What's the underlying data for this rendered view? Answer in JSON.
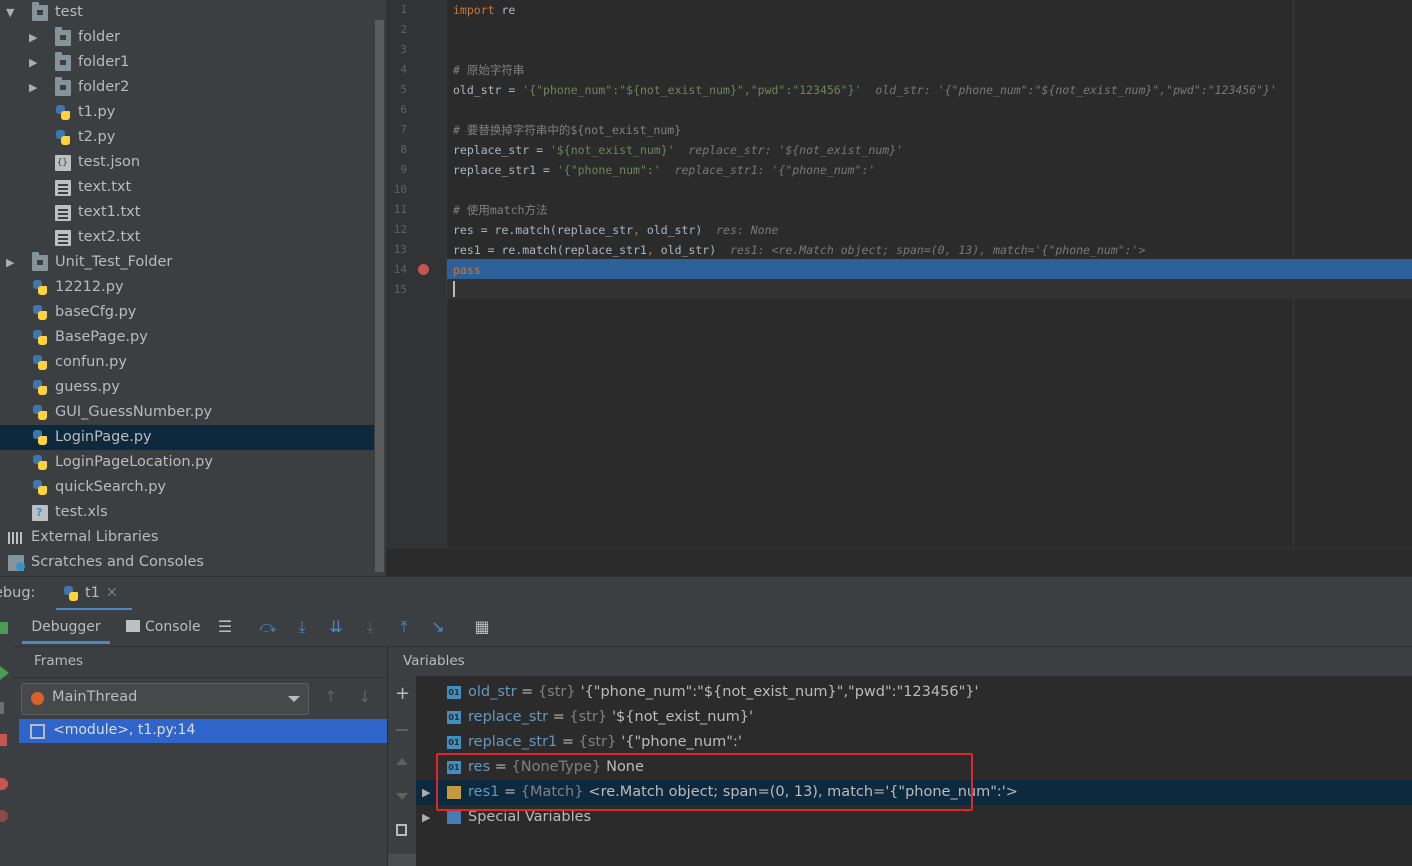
{
  "tree": {
    "items": [
      {
        "label": "test",
        "type": "folder",
        "expanded": true,
        "level": 0
      },
      {
        "label": "folder",
        "type": "folder",
        "expanded": false,
        "level": 1
      },
      {
        "label": "folder1",
        "type": "folder",
        "expanded": false,
        "level": 1
      },
      {
        "label": "folder2",
        "type": "folder",
        "expanded": false,
        "level": 1
      },
      {
        "label": "t1.py",
        "type": "python",
        "level": 1
      },
      {
        "label": "t2.py",
        "type": "python",
        "level": 1
      },
      {
        "label": "test.json",
        "type": "json",
        "level": 1
      },
      {
        "label": "text.txt",
        "type": "text",
        "level": 1
      },
      {
        "label": "text1.txt",
        "type": "text",
        "level": 1
      },
      {
        "label": "text2.txt",
        "type": "text",
        "level": 1
      },
      {
        "label": "Unit_Test_Folder",
        "type": "folder",
        "expanded": false,
        "level": 0
      },
      {
        "label": "12212.py",
        "type": "python",
        "level": 0
      },
      {
        "label": "baseCfg.py",
        "type": "python",
        "level": 0
      },
      {
        "label": "BasePage.py",
        "type": "python",
        "level": 0
      },
      {
        "label": "confun.py",
        "type": "python",
        "level": 0
      },
      {
        "label": "guess.py",
        "type": "python",
        "level": 0
      },
      {
        "label": "GUI_GuessNumber.py",
        "type": "python",
        "level": 0
      },
      {
        "label": "LoginPage.py",
        "type": "python",
        "level": 0,
        "selected": true
      },
      {
        "label": "LoginPageLocation.py",
        "type": "python",
        "level": 0
      },
      {
        "label": "quickSearch.py",
        "type": "python",
        "level": 0
      },
      {
        "label": "test.xls",
        "type": "xls",
        "level": 0
      },
      {
        "label": "External Libraries",
        "type": "library",
        "level": -1
      },
      {
        "label": "Scratches and Consoles",
        "type": "scratch",
        "level": -1
      }
    ]
  },
  "editor": {
    "lines": [
      {
        "n": "1",
        "html_parts": [
          [
            "kw",
            "import"
          ],
          [
            "plain",
            " re"
          ]
        ]
      },
      {
        "n": "2",
        "html_parts": []
      },
      {
        "n": "3",
        "html_parts": []
      },
      {
        "n": "4",
        "html_parts": [
          [
            "cmt",
            "# 原始字符串"
          ]
        ]
      },
      {
        "n": "5",
        "html_parts": [
          [
            "plain",
            "old_str = "
          ],
          [
            "str",
            "'{\"phone_num\":\"${not_exist_num}\",\"pwd\":\"123456\"}'"
          ],
          [
            "hint",
            "  old_str: '{\"phone_num\":\"${not_exist_num}\",\"pwd\":\"123456\"}'"
          ]
        ]
      },
      {
        "n": "6",
        "html_parts": []
      },
      {
        "n": "7",
        "html_parts": [
          [
            "cmt",
            "# 要替换掉字符串中的${not_exist_num}"
          ]
        ]
      },
      {
        "n": "8",
        "html_parts": [
          [
            "plain",
            "replace_str = "
          ],
          [
            "str",
            "'${not_exist_num}'"
          ],
          [
            "hint",
            "  replace_str: '${not_exist_num}'"
          ]
        ]
      },
      {
        "n": "9",
        "html_parts": [
          [
            "plain",
            "replace_str1 = "
          ],
          [
            "str",
            "'{\"phone_num\":'"
          ],
          [
            "hint",
            "  replace_str1: '{\"phone_num\":'"
          ]
        ]
      },
      {
        "n": "10",
        "html_parts": []
      },
      {
        "n": "11",
        "html_parts": [
          [
            "cmt",
            "# 使用match方法"
          ]
        ]
      },
      {
        "n": "12",
        "html_parts": [
          [
            "plain",
            "res = re.match(replace_str"
          ],
          [
            "op",
            ","
          ],
          [
            "plain",
            " old_str)"
          ],
          [
            "hint",
            "  res: None"
          ]
        ]
      },
      {
        "n": "13",
        "html_parts": [
          [
            "plain",
            "res1 = re.match(replace_str1"
          ],
          [
            "op",
            ","
          ],
          [
            "plain",
            " old_str)"
          ],
          [
            "hint",
            "  res1: <re.Match object; span=(0, 13), match='{\"phone_num\":'>"
          ]
        ]
      },
      {
        "n": "14",
        "html_parts": [
          [
            "kw",
            "pass"
          ]
        ],
        "breakpoint": true,
        "highlighted": true
      },
      {
        "n": "15",
        "html_parts": [],
        "current": true
      }
    ]
  },
  "debug": {
    "title": "ebug:",
    "run_tab": "t1",
    "tabs": {
      "debugger": "Debugger",
      "console": "Console"
    },
    "frames_title": "Frames",
    "thread": "MainThread",
    "frame": "<module>, t1.py:14",
    "variables_title": "Variables",
    "variables": [
      {
        "name": "old_str",
        "eq": " = ",
        "type": "{str}",
        "value": "'{\"phone_num\":\"${not_exist_num}\",\"pwd\":\"123456\"}'",
        "icon": "01",
        "expandable": false
      },
      {
        "name": "replace_str",
        "eq": " = ",
        "type": "{str}",
        "value": "'${not_exist_num}'",
        "icon": "01",
        "expandable": false
      },
      {
        "name": "replace_str1",
        "eq": " = ",
        "type": "{str}",
        "value": "'{\"phone_num\":'",
        "icon": "01",
        "expandable": false
      },
      {
        "name": "res",
        "eq": " = ",
        "type": "{NoneType}",
        "value": "None",
        "icon": "01",
        "expandable": false
      },
      {
        "name": "res1",
        "eq": " = ",
        "type": "{Match}",
        "value": "<re.Match object; span=(0, 13), match='{\"phone_num\":'>",
        "icon": "match",
        "expandable": true,
        "selected": true
      },
      {
        "name": "Special Variables",
        "eq": "",
        "type": "",
        "value": "",
        "icon": "special",
        "expandable": true,
        "plain": true
      }
    ]
  },
  "colors": {
    "selection": "#0d293e",
    "execution_line": "#2d6099",
    "breakpoint": "#c75450",
    "highlight_box": "#e0262a"
  }
}
